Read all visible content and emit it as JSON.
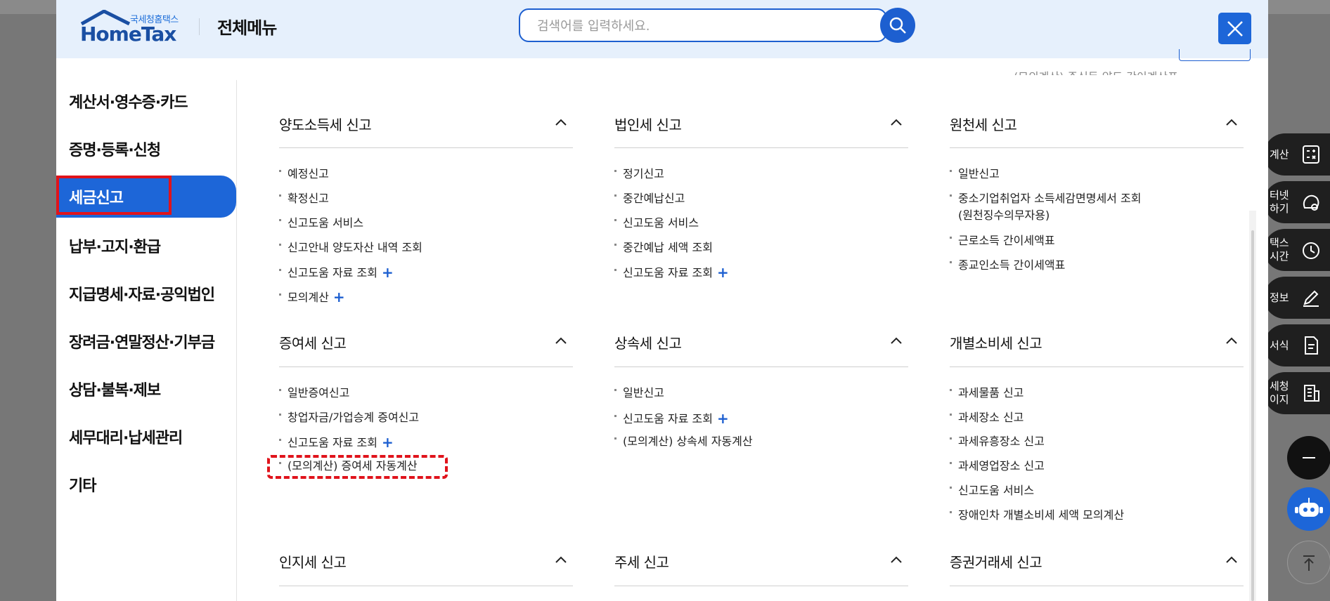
{
  "header": {
    "logo_small": "국세청홈택스",
    "logo_main": "HomeTax",
    "title": "전체메뉴",
    "search_placeholder": "검색어를 입력하세요.",
    "search_icon": "search-icon",
    "close_icon": "close-icon"
  },
  "sidebar": {
    "items": [
      {
        "label": "계산서·영수증·카드"
      },
      {
        "label": "증명·등록·신청"
      },
      {
        "label": "세금신고",
        "active": true
      },
      {
        "label": "납부·고지·환급"
      },
      {
        "label": "지급명세·자료·공익법인"
      },
      {
        "label": "장려금·연말정산·기부금"
      },
      {
        "label": "상담·불복·제보"
      },
      {
        "label": "세무대리·납세관리"
      },
      {
        "label": "기타"
      }
    ]
  },
  "clipped_text": "(모의계산) 주식등 양도 간이계산표",
  "sections": [
    {
      "title": "양도소득세 신고",
      "links": [
        {
          "label": "예정신고"
        },
        {
          "label": "확정신고"
        },
        {
          "label": "신고도움 서비스"
        },
        {
          "label": "신고안내 양도자산 내역 조회"
        },
        {
          "label": "신고도움 자료 조회",
          "plus": "+"
        },
        {
          "label": "모의계산",
          "plus": "+"
        }
      ]
    },
    {
      "title": "법인세 신고",
      "links": [
        {
          "label": "정기신고"
        },
        {
          "label": "중간예납신고"
        },
        {
          "label": "신고도움 서비스"
        },
        {
          "label": "중간예납 세액 조회"
        },
        {
          "label": "신고도움 자료 조회",
          "plus": "+"
        }
      ]
    },
    {
      "title": "원천세 신고",
      "links": [
        {
          "label": "일반신고"
        },
        {
          "label": "중소기업취업자 소득세감면명세서 조회",
          "label2": "(원천징수의무자용)"
        },
        {
          "label": "근로소득 간이세액표"
        },
        {
          "label": "종교인소득 간이세액표"
        }
      ]
    },
    {
      "title": "증여세 신고",
      "links": [
        {
          "label": "일반증여신고"
        },
        {
          "label": "창업자금/가업승계 증여신고"
        },
        {
          "label": "신고도움 자료 조회",
          "plus": "+"
        },
        {
          "label": "(모의계산) 증여세 자동계산"
        }
      ]
    },
    {
      "title": "상속세 신고",
      "links": [
        {
          "label": "일반신고"
        },
        {
          "label": "신고도움 자료 조회",
          "plus": "+"
        },
        {
          "label": "(모의계산) 상속세 자동계산"
        }
      ]
    },
    {
      "title": "개별소비세 신고",
      "links": [
        {
          "label": "과세물품 신고"
        },
        {
          "label": "과세장소 신고"
        },
        {
          "label": "과세유흥장소 신고"
        },
        {
          "label": "과세영업장소 신고"
        },
        {
          "label": "신고도움 서비스"
        },
        {
          "label": "장애인차 개별소비세 세액 모의계산"
        }
      ]
    },
    {
      "title": "인지세 신고",
      "links": []
    },
    {
      "title": "주세 신고",
      "links": []
    },
    {
      "title": "증권거래세 신고",
      "links": []
    }
  ],
  "quick_menu": {
    "items": [
      {
        "label": "계산",
        "icon": "calculator-icon"
      },
      {
        "label": "터넷\n하기",
        "icon": "chat-icon"
      },
      {
        "label": "택스\n시간",
        "icon": "clock-icon"
      },
      {
        "label": "정보",
        "icon": "pen-icon"
      },
      {
        "label": "서식",
        "icon": "document-icon"
      },
      {
        "label": "세청\n이지",
        "icon": "building-icon"
      }
    ],
    "collapse_icon": "minus-icon",
    "chatbot_icon": "robot-icon",
    "top_icon": "arrow-up-icon"
  }
}
